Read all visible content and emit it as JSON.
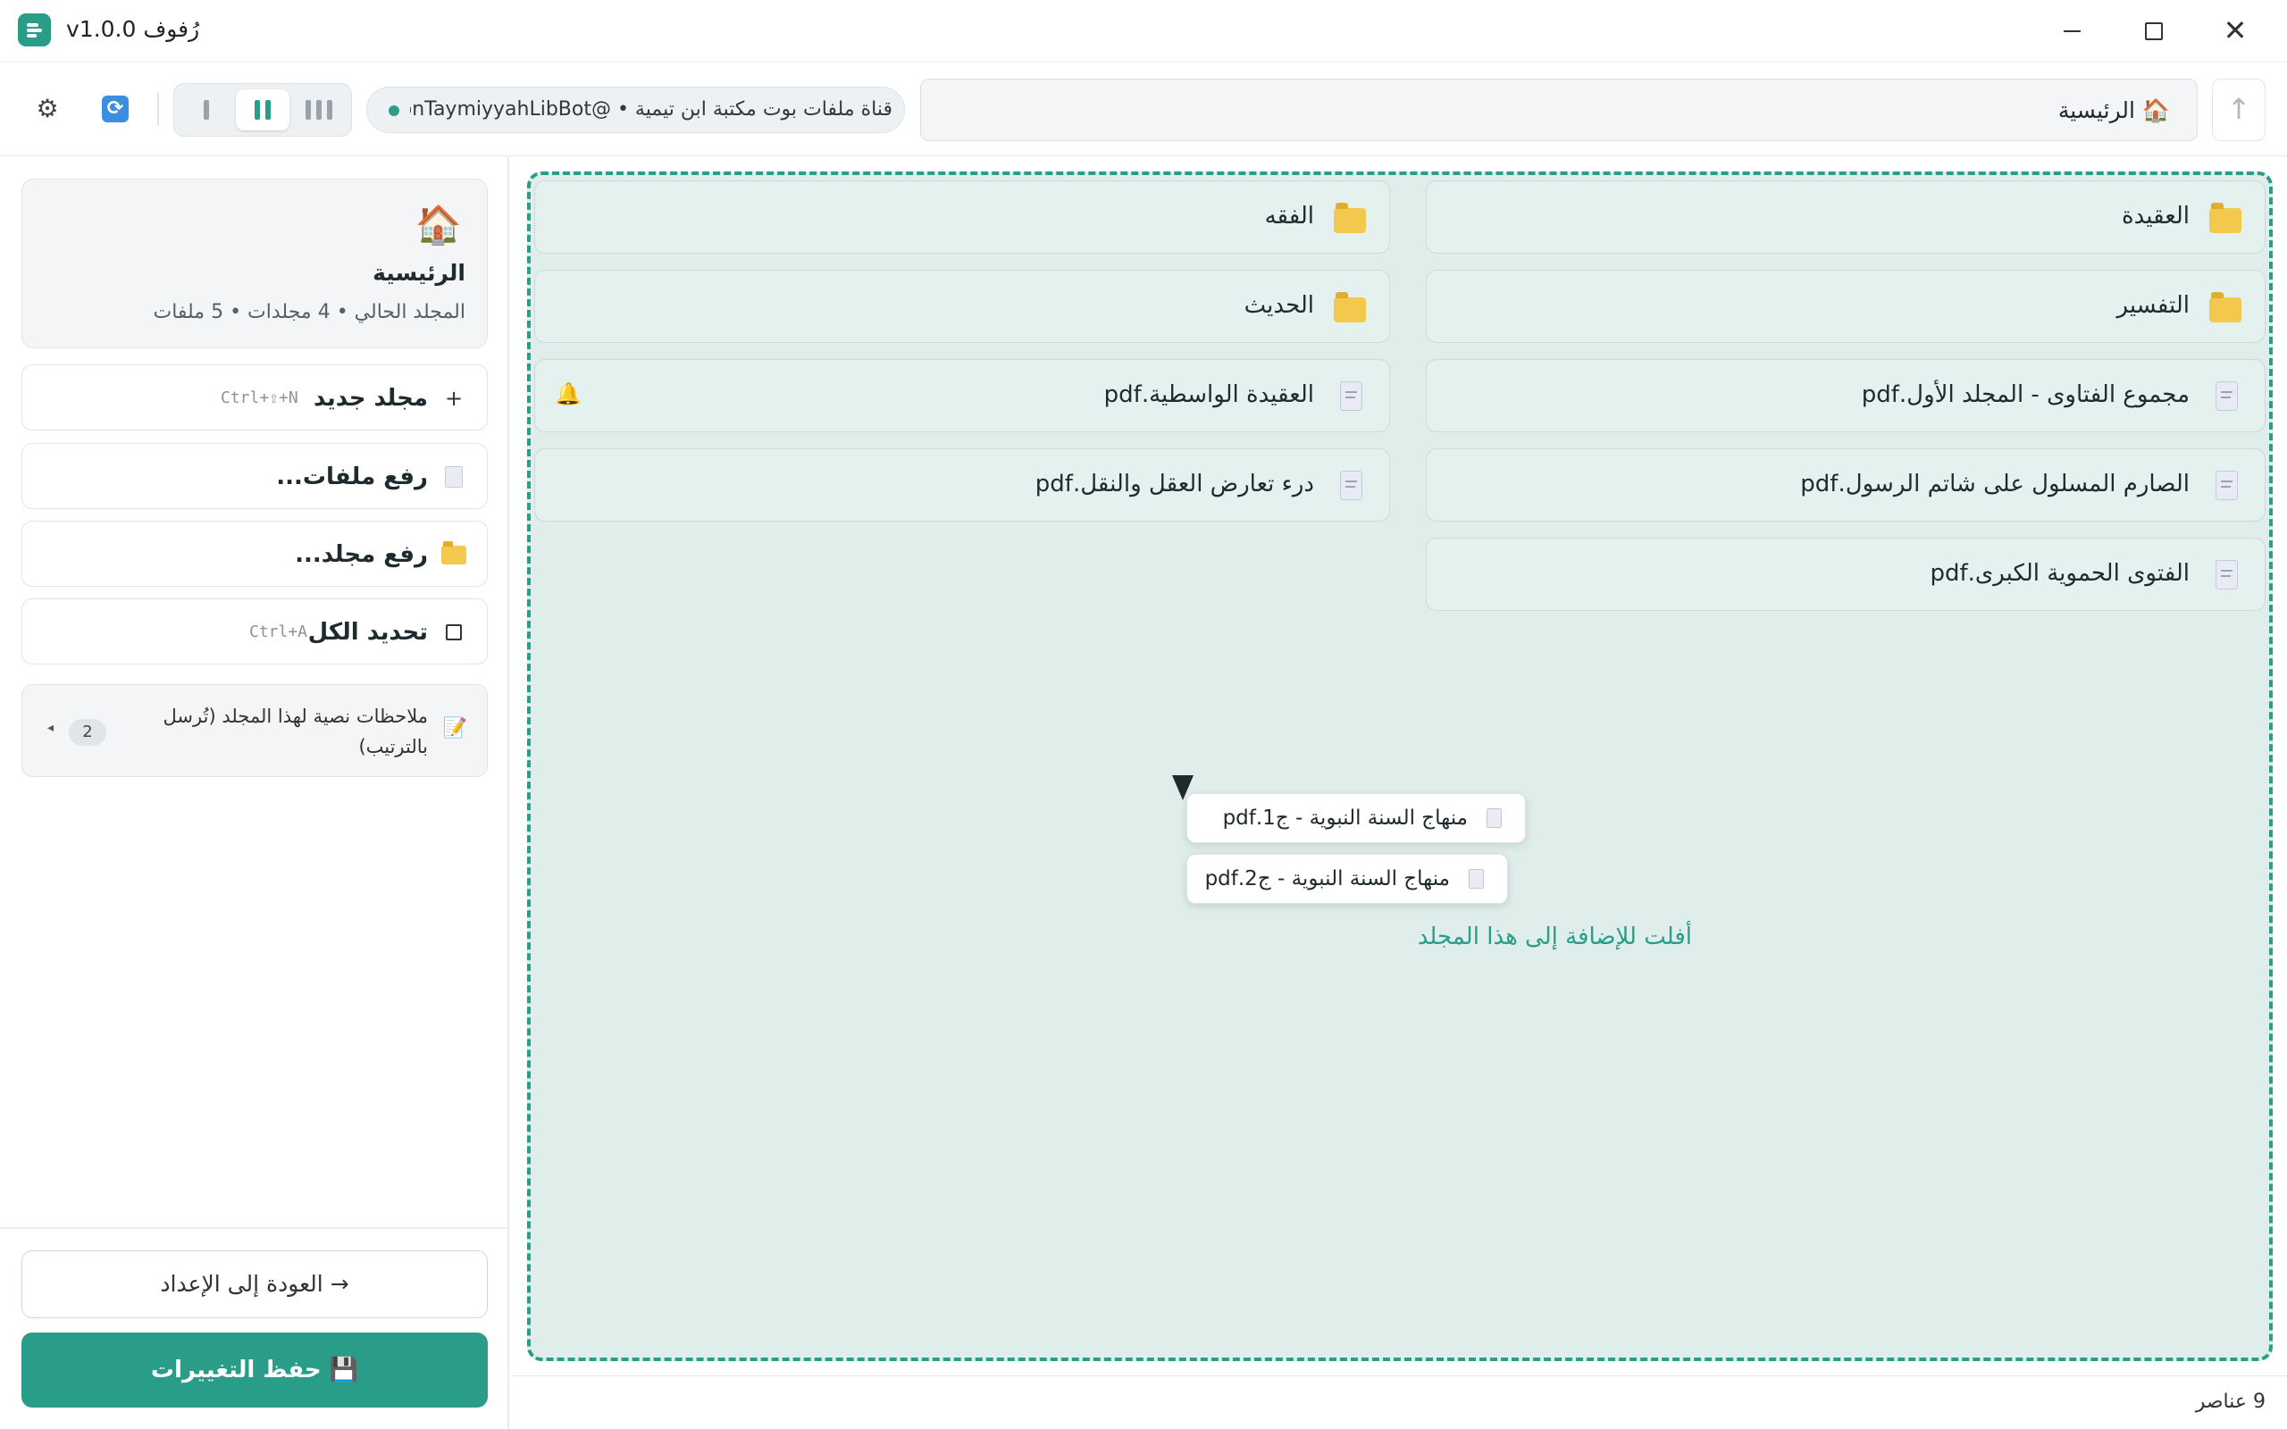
{
  "window": {
    "title": "رُفوف v1.0.0",
    "close_glyph": "✕"
  },
  "toolbar": {
    "settings_icon": "⚙",
    "sync_icon": "🔄",
    "bot_status": "قناة ملفات بوت مكتبة ابن تيمية • @IbnTaymiyyahLibBot",
    "breadcrumb": "🏠 الرئيسية",
    "up_icon": "↑",
    "accent_color": "#2a9d88"
  },
  "sidebar": {
    "current": {
      "icon": "🏠",
      "title": "الرئيسية",
      "subtitle": "المجلد الحالي • 4 مجلدات • 5 ملفات"
    },
    "actions": [
      {
        "icon": "+",
        "label": "مجلد جديد",
        "shortcut": "Ctrl+⇧+N"
      },
      {
        "icon": "doc",
        "label": "رفع ملفات..."
      },
      {
        "icon": "folder",
        "label": "رفع مجلد..."
      },
      {
        "icon": "checkbox",
        "label": "تحديد الكل",
        "shortcut": "Ctrl+A"
      }
    ],
    "notes": {
      "icon": "📝",
      "label": "ملاحظات نصية لهذا المجلد (تُرسل بالترتيب)",
      "count": "2",
      "caret": "◂"
    },
    "back_label": "→ العودة إلى الإعداد",
    "save_label": "💾 حفظ التغييرات"
  },
  "items": [
    {
      "type": "folder",
      "name": "العقيدة"
    },
    {
      "type": "folder",
      "name": "الفقه"
    },
    {
      "type": "folder",
      "name": "التفسير"
    },
    {
      "type": "folder",
      "name": "الحديث"
    },
    {
      "type": "file",
      "name": "مجموع الفتاوى - المجلد الأول.pdf"
    },
    {
      "type": "file",
      "name": "العقيدة الواسطية.pdf",
      "badge": "🔔"
    },
    {
      "type": "file",
      "name": "الصارم المسلول على شاتم الرسول.pdf"
    },
    {
      "type": "file",
      "name": "درء تعارض العقل والنقل.pdf"
    },
    {
      "type": "file",
      "name": "الفتوى الحموية الكبرى.pdf"
    }
  ],
  "drop": {
    "hint": "أفلت للإضافة إلى هذا المجلد",
    "dragged": [
      "منهاج السنة النبوية - ج1.pdf",
      "منهاج السنة النبوية - ج2.pdf"
    ]
  },
  "status": {
    "count": "9 عناصر"
  }
}
